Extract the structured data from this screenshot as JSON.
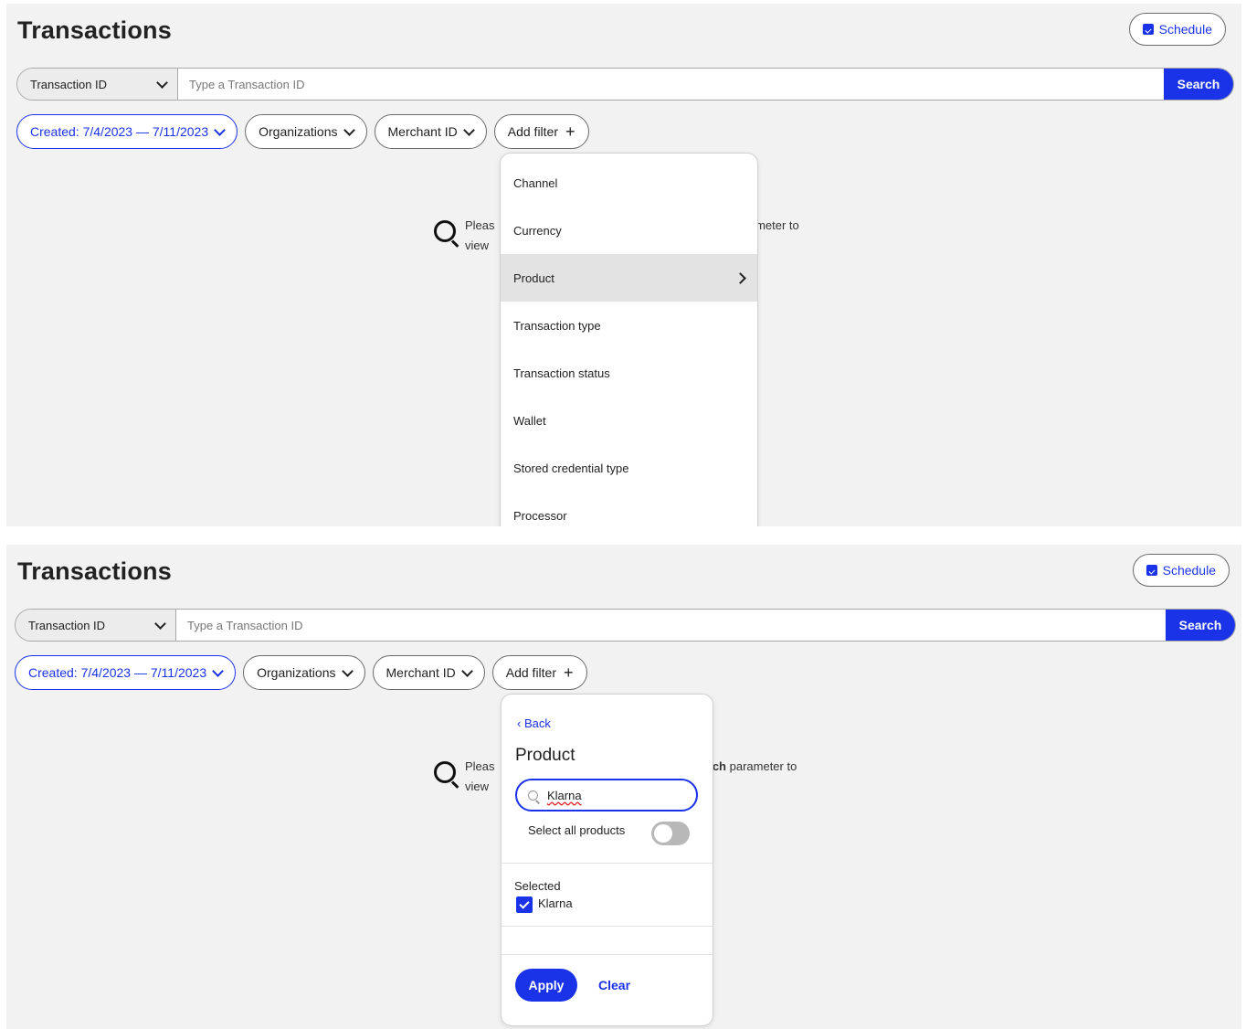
{
  "header": {
    "title": "Transactions",
    "schedule_label": "Schedule"
  },
  "search": {
    "selector_label": "Transaction ID",
    "placeholder": "Type a Transaction ID",
    "button_label": "Search"
  },
  "filters": {
    "created": "Created: 7/4/2023 — 7/11/2023",
    "organizations": "Organizations",
    "merchant_id": "Merchant ID",
    "add_filter": "Add filter"
  },
  "empty_state": {
    "top_prefix": "Pleas",
    "top_suffix": "rameter to",
    "top_view": "view",
    "bottom_prefix": "Pleas",
    "bottom_bold": "arch",
    "bottom_suffix": " parameter to",
    "bottom_view": "view"
  },
  "add_filter_menu": {
    "items": [
      "Channel",
      "Currency",
      "Product",
      "Transaction type",
      "Transaction status",
      "Wallet",
      "Stored credential type",
      "Processor"
    ],
    "active_index": 2
  },
  "product_panel": {
    "back_label": "Back",
    "title": "Product",
    "search_value": "Klarna",
    "select_all_label": "Select all products",
    "select_all_enabled": false,
    "selected_heading": "Selected",
    "selected_items": [
      "Klarna"
    ],
    "apply_label": "Apply",
    "clear_label": "Clear"
  },
  "colors": {
    "accent": "#1a33e8",
    "panel_bg": "#f2f2f2"
  }
}
